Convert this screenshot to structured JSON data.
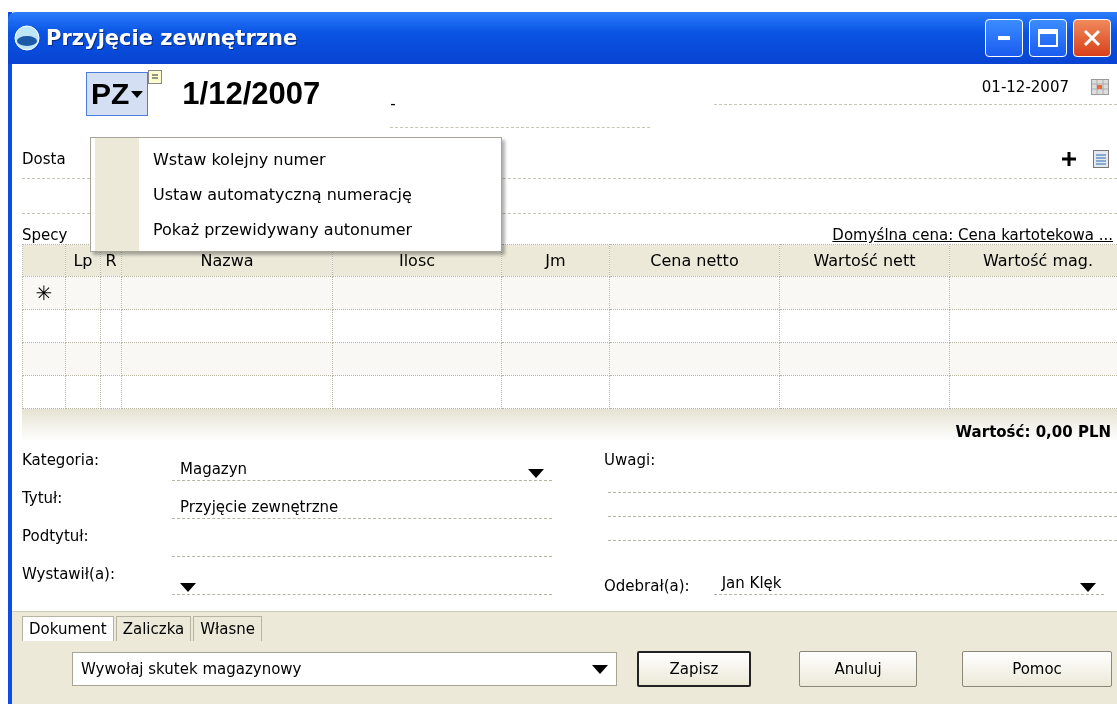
{
  "window": {
    "title": "Przyjęcie zewnętrzne"
  },
  "header": {
    "doc_type": "PZ",
    "number": "1/12/2007",
    "separator": "-",
    "date": "01-12-2007"
  },
  "doc_type_menu": [
    {
      "label": "Wstaw kolejny numer"
    },
    {
      "label": "Ustaw automatyczną numerację"
    },
    {
      "label": "Pokaż przewidywany autonumer"
    }
  ],
  "supplier": {
    "label": "Dosta"
  },
  "spec": {
    "label": "Specy",
    "default_price_link": "Domyślna cena: Cena kartotekowa ..."
  },
  "table": {
    "columns": [
      "Lp",
      "R",
      "Nazwa",
      "Ilosc",
      "Jm",
      "Cena netto",
      "Wartość nett",
      "Wartość mag."
    ],
    "new_row_marker": "✳",
    "rows": [
      {
        "new": true
      },
      {
        "new": false
      },
      {
        "new": false
      },
      {
        "new": false
      }
    ]
  },
  "total": "Wartość: 0,00 PLN",
  "fields": [
    {
      "label": "Kategoria:",
      "value": "Magazyn",
      "kind": "dropdown"
    },
    {
      "label": "Tytuł:",
      "value": "Przyjęcie zewnętrzne",
      "kind": "text"
    },
    {
      "label": "Podtytuł:",
      "kind": "text"
    },
    {
      "label": "Wystawił(a):",
      "kind": "dropdown"
    }
  ],
  "remarks": {
    "label": "Uwagi:"
  },
  "receiver": {
    "label": "Odebrał(a):",
    "value": "Jan Klęk"
  },
  "tabs": [
    {
      "label": "Dokument",
      "selected": true
    },
    {
      "label": "Zaliczka",
      "selected": false
    },
    {
      "label": "Własne",
      "selected": false
    }
  ],
  "effect_dropdown": {
    "value": "Wywołaj skutek magazynowy"
  },
  "buttons": [
    {
      "label": "Zapisz",
      "default": true
    },
    {
      "label": "Anuluj",
      "default": false
    },
    {
      "label": "Pomoc",
      "default": false
    }
  ]
}
